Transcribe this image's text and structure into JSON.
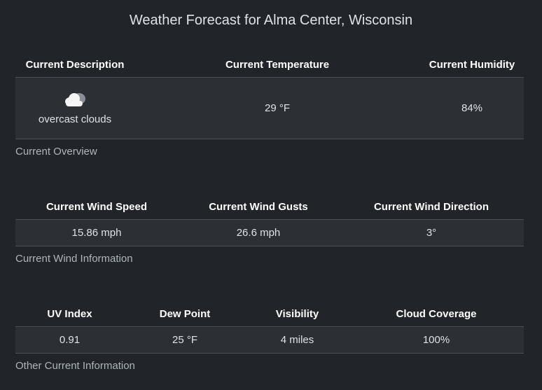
{
  "page": {
    "title": "Weather Forecast for Alma Center, Wisconsin"
  },
  "overview": {
    "headers": [
      "Current Description",
      "Current Temperature",
      "Current Humidity"
    ],
    "icon": "overcast-clouds-icon",
    "description": "overcast clouds",
    "temperature": "29 °F",
    "humidity": "84%",
    "caption": "Current Overview"
  },
  "wind": {
    "headers": [
      "Current Wind Speed",
      "Current Wind Gusts",
      "Current Wind Direction"
    ],
    "values": [
      "15.86 mph",
      "26.6 mph",
      "3°"
    ],
    "caption": "Current Wind Information"
  },
  "other": {
    "headers": [
      "UV Index",
      "Dew Point",
      "Visibility",
      "Cloud Coverage"
    ],
    "values": [
      "0.91",
      "25 °F",
      "4 miles",
      "100%"
    ],
    "caption": "Other Current Information"
  }
}
